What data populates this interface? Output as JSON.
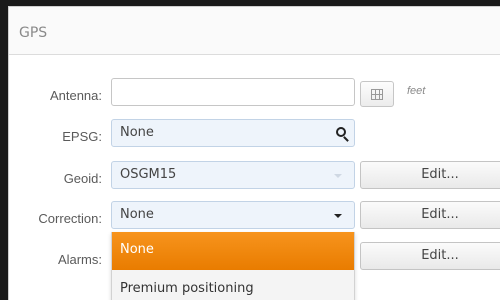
{
  "panel": {
    "title": "GPS"
  },
  "antenna": {
    "label": "Antenna:",
    "value": "",
    "unit": "feet"
  },
  "epsg": {
    "label": "EPSG:",
    "value": "None"
  },
  "geoid": {
    "label": "Geoid:",
    "value": "OSGM15",
    "edit_label": "Edit..."
  },
  "correction": {
    "label": "Correction:",
    "value": "None",
    "edit_label": "Edit..."
  },
  "alarms": {
    "label": "Alarms:",
    "edit_label": "Edit..."
  },
  "correction_dropdown": {
    "options": [
      "None",
      "Premium positioning"
    ],
    "selected_index": 0
  },
  "colors": {
    "selected_option": "#f39200",
    "field_blue": "#eef4fb"
  },
  "icons": {
    "antenna_button": "grid-icon",
    "epsg_search": "search-icon"
  }
}
